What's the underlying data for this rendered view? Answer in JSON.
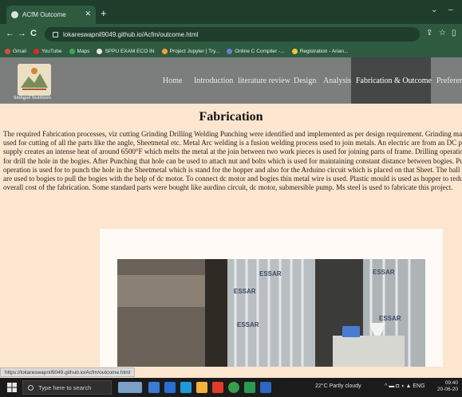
{
  "browser": {
    "tab_title": "ACfM Outcome",
    "tab_close": "✕",
    "new_tab": "+",
    "win_controls": [
      "⌄",
      "–"
    ],
    "nav_back": "←",
    "nav_forward": "→",
    "nav_reload": "C",
    "url": "lokareswapnil9049.github.io/Acfm/outcome.html",
    "addr_right_icons": [
      "⇪",
      "☆",
      "▯"
    ],
    "bookmarks": [
      {
        "label": "Gmail",
        "color": "#d84b3d"
      },
      {
        "label": "YouTube",
        "color": "#e02a20"
      },
      {
        "label": "Maps",
        "color": "#3aa757"
      },
      {
        "label": "SPPU EXAM ECO IN",
        "color": "#e9e9e9"
      },
      {
        "label": "Project Jupyter | Try...",
        "color": "#f2a03a"
      },
      {
        "label": "Online C Compiler -...",
        "color": "#6d7bd8"
      },
      {
        "label": "Registration - Arian...",
        "color": "#f0c43a"
      }
    ]
  },
  "site": {
    "logo_text": "Sinhgad Institutes",
    "menu": [
      {
        "label": "Home",
        "active": false
      },
      {
        "label": "Introduction",
        "active": false
      },
      {
        "label": "literature review",
        "active": false
      },
      {
        "label": "Design",
        "active": false
      },
      {
        "label": "Analysis",
        "active": false
      },
      {
        "label": "Fabrication & Outcome",
        "active": true
      },
      {
        "label": "Preference",
        "active": false
      }
    ]
  },
  "content": {
    "title": "Fabrication",
    "paragraph_lines": [
      "The required Fabrication processes, viz cutting Grinding Drilling Welding Punching were identified and implemented as per design requirement. Grinding machin",
      "used for cutting of all the parts like the angle, Sheetmetal etc. Metal Arc welding is a fusion welding process used to join metals. An electric are from an DC powe",
      "supply creates an intense heat of around 6500°F which melts the metal at the join between two work pieces is used for joining parts of frame. Drilling operation is",
      "for drill the hole in the bogies. After Punching that hole can be used to attach nut and bolts which is used for maintaining constant distance between bogies. Punch",
      "operation is used for to punch the hole in the Sheetmetal which is stand for the hopper and also for the Arduino circuit which is placed on that Sheet. The ball bear",
      "are used to bogies to pull the bogies with the help of dc motor. To connect dc motor and bogies thin metal wire is used. Plastic mould is used as hopper to reduce th",
      "overall cost of the fabrication. Some standard parts were bought like aurdino circuit, dc motor, submersible pump. Ms steel is used to fabricate this project."
    ],
    "photo_labels": [
      "ESSAR",
      "ESSAR",
      "ESSAR",
      "ESSAR",
      "ESSAR"
    ]
  },
  "status_url": "https://lokareswapnil9049.github.io/Acfm/outcome.html",
  "taskbar": {
    "search_placeholder": "Type here to search",
    "weather": "22°C  Partly cloudy",
    "tray": "^ ▬ ◘ ◖ ▲ ENG",
    "time": "09:40",
    "date": "20-06-20"
  }
}
